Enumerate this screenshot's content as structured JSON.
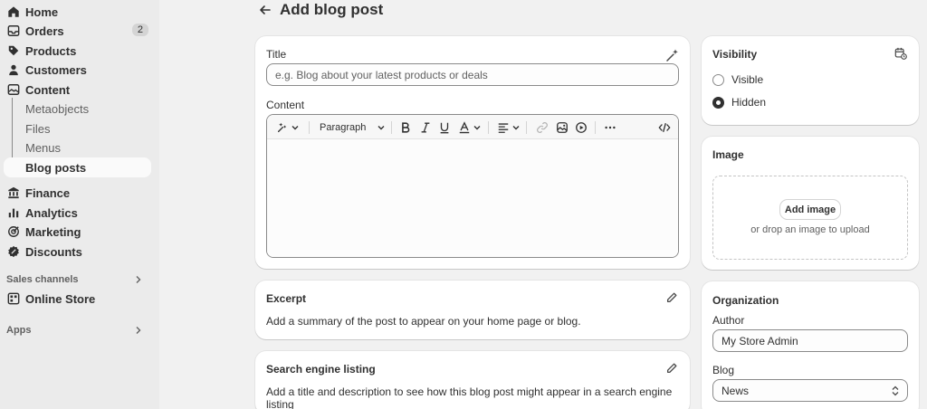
{
  "sidebar": {
    "items": [
      {
        "label": "Home",
        "icon": "home-icon"
      },
      {
        "label": "Orders",
        "icon": "inbox-icon",
        "badge": "2"
      },
      {
        "label": "Products",
        "icon": "tag-icon"
      },
      {
        "label": "Customers",
        "icon": "person-icon"
      },
      {
        "label": "Content",
        "icon": "image-icon"
      }
    ],
    "content_sub": [
      {
        "label": "Metaobjects"
      },
      {
        "label": "Files"
      },
      {
        "label": "Menus"
      },
      {
        "label": "Blog posts",
        "active": true
      }
    ],
    "items2": [
      {
        "label": "Finance",
        "icon": "bank-icon"
      },
      {
        "label": "Analytics",
        "icon": "bar-chart-icon"
      },
      {
        "label": "Marketing",
        "icon": "target-icon"
      },
      {
        "label": "Discounts",
        "icon": "discount-icon"
      }
    ],
    "sales_channels_label": "Sales channels",
    "online_store_label": "Online Store",
    "apps_label": "Apps"
  },
  "page": {
    "title": "Add blog post"
  },
  "title_card": {
    "title_label": "Title",
    "title_placeholder": "e.g. Blog about your latest products or deals",
    "content_label": "Content",
    "paragraph_label": "Paragraph"
  },
  "excerpt_card": {
    "title": "Excerpt",
    "text": "Add a summary of the post to appear on your home page or blog."
  },
  "seo_card": {
    "title": "Search engine listing",
    "text": "Add a title and description to see how this blog post might appear in a search engine listing"
  },
  "visibility_card": {
    "title": "Visibility",
    "options": [
      {
        "label": "Visible",
        "selected": false
      },
      {
        "label": "Hidden",
        "selected": true
      }
    ]
  },
  "image_card": {
    "title": "Image",
    "button_label": "Add image",
    "hint": "or drop an image to upload"
  },
  "organization_card": {
    "title": "Organization",
    "author_label": "Author",
    "author_value": "My Store Admin",
    "blog_label": "Blog",
    "blog_value": "News"
  },
  "colors": {
    "sidebar_bg": "#ebebeb",
    "page_bg": "#f1f1f1",
    "text": "#303030",
    "muted": "#616161"
  }
}
